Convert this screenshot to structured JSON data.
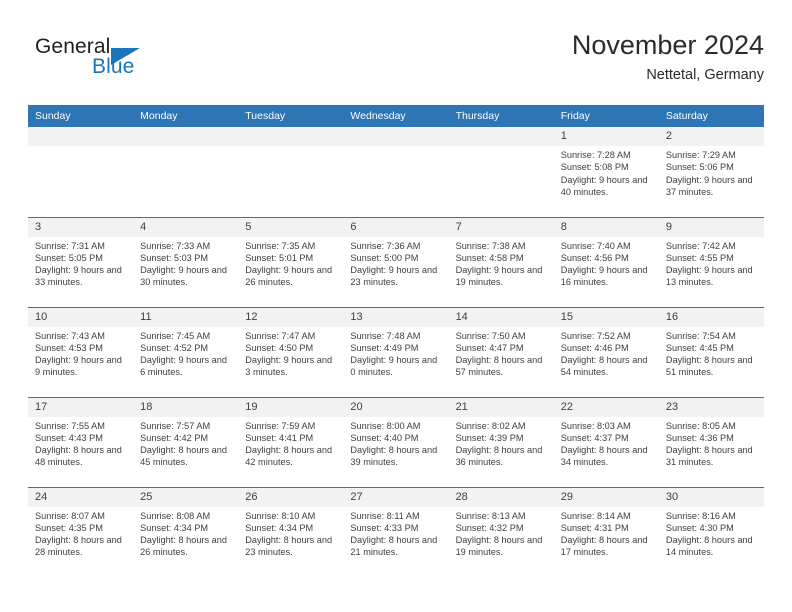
{
  "brand": {
    "name_part1": "General",
    "name_part2": "Blue",
    "accent_color": "#1b75bb",
    "logo_icon": "triangle-icon"
  },
  "header": {
    "title": "November 2024",
    "location": "Nettetal, Germany",
    "header_bg": "#2e75b6",
    "daynum_bg": "#f2f2f2"
  },
  "weekdays": [
    "Sunday",
    "Monday",
    "Tuesday",
    "Wednesday",
    "Thursday",
    "Friday",
    "Saturday"
  ],
  "weeks": [
    [
      {
        "day": "",
        "empty": true
      },
      {
        "day": "",
        "empty": true
      },
      {
        "day": "",
        "empty": true
      },
      {
        "day": "",
        "empty": true
      },
      {
        "day": "",
        "empty": true
      },
      {
        "day": "1",
        "sunrise": "Sunrise: 7:28 AM",
        "sunset": "Sunset: 5:08 PM",
        "daylight": "Daylight: 9 hours and 40 minutes."
      },
      {
        "day": "2",
        "sunrise": "Sunrise: 7:29 AM",
        "sunset": "Sunset: 5:06 PM",
        "daylight": "Daylight: 9 hours and 37 minutes."
      }
    ],
    [
      {
        "day": "3",
        "sunrise": "Sunrise: 7:31 AM",
        "sunset": "Sunset: 5:05 PM",
        "daylight": "Daylight: 9 hours and 33 minutes."
      },
      {
        "day": "4",
        "sunrise": "Sunrise: 7:33 AM",
        "sunset": "Sunset: 5:03 PM",
        "daylight": "Daylight: 9 hours and 30 minutes."
      },
      {
        "day": "5",
        "sunrise": "Sunrise: 7:35 AM",
        "sunset": "Sunset: 5:01 PM",
        "daylight": "Daylight: 9 hours and 26 minutes."
      },
      {
        "day": "6",
        "sunrise": "Sunrise: 7:36 AM",
        "sunset": "Sunset: 5:00 PM",
        "daylight": "Daylight: 9 hours and 23 minutes."
      },
      {
        "day": "7",
        "sunrise": "Sunrise: 7:38 AM",
        "sunset": "Sunset: 4:58 PM",
        "daylight": "Daylight: 9 hours and 19 minutes."
      },
      {
        "day": "8",
        "sunrise": "Sunrise: 7:40 AM",
        "sunset": "Sunset: 4:56 PM",
        "daylight": "Daylight: 9 hours and 16 minutes."
      },
      {
        "day": "9",
        "sunrise": "Sunrise: 7:42 AM",
        "sunset": "Sunset: 4:55 PM",
        "daylight": "Daylight: 9 hours and 13 minutes."
      }
    ],
    [
      {
        "day": "10",
        "sunrise": "Sunrise: 7:43 AM",
        "sunset": "Sunset: 4:53 PM",
        "daylight": "Daylight: 9 hours and 9 minutes."
      },
      {
        "day": "11",
        "sunrise": "Sunrise: 7:45 AM",
        "sunset": "Sunset: 4:52 PM",
        "daylight": "Daylight: 9 hours and 6 minutes."
      },
      {
        "day": "12",
        "sunrise": "Sunrise: 7:47 AM",
        "sunset": "Sunset: 4:50 PM",
        "daylight": "Daylight: 9 hours and 3 minutes."
      },
      {
        "day": "13",
        "sunrise": "Sunrise: 7:48 AM",
        "sunset": "Sunset: 4:49 PM",
        "daylight": "Daylight: 9 hours and 0 minutes."
      },
      {
        "day": "14",
        "sunrise": "Sunrise: 7:50 AM",
        "sunset": "Sunset: 4:47 PM",
        "daylight": "Daylight: 8 hours and 57 minutes."
      },
      {
        "day": "15",
        "sunrise": "Sunrise: 7:52 AM",
        "sunset": "Sunset: 4:46 PM",
        "daylight": "Daylight: 8 hours and 54 minutes."
      },
      {
        "day": "16",
        "sunrise": "Sunrise: 7:54 AM",
        "sunset": "Sunset: 4:45 PM",
        "daylight": "Daylight: 8 hours and 51 minutes."
      }
    ],
    [
      {
        "day": "17",
        "sunrise": "Sunrise: 7:55 AM",
        "sunset": "Sunset: 4:43 PM",
        "daylight": "Daylight: 8 hours and 48 minutes."
      },
      {
        "day": "18",
        "sunrise": "Sunrise: 7:57 AM",
        "sunset": "Sunset: 4:42 PM",
        "daylight": "Daylight: 8 hours and 45 minutes."
      },
      {
        "day": "19",
        "sunrise": "Sunrise: 7:59 AM",
        "sunset": "Sunset: 4:41 PM",
        "daylight": "Daylight: 8 hours and 42 minutes."
      },
      {
        "day": "20",
        "sunrise": "Sunrise: 8:00 AM",
        "sunset": "Sunset: 4:40 PM",
        "daylight": "Daylight: 8 hours and 39 minutes."
      },
      {
        "day": "21",
        "sunrise": "Sunrise: 8:02 AM",
        "sunset": "Sunset: 4:39 PM",
        "daylight": "Daylight: 8 hours and 36 minutes."
      },
      {
        "day": "22",
        "sunrise": "Sunrise: 8:03 AM",
        "sunset": "Sunset: 4:37 PM",
        "daylight": "Daylight: 8 hours and 34 minutes."
      },
      {
        "day": "23",
        "sunrise": "Sunrise: 8:05 AM",
        "sunset": "Sunset: 4:36 PM",
        "daylight": "Daylight: 8 hours and 31 minutes."
      }
    ],
    [
      {
        "day": "24",
        "sunrise": "Sunrise: 8:07 AM",
        "sunset": "Sunset: 4:35 PM",
        "daylight": "Daylight: 8 hours and 28 minutes."
      },
      {
        "day": "25",
        "sunrise": "Sunrise: 8:08 AM",
        "sunset": "Sunset: 4:34 PM",
        "daylight": "Daylight: 8 hours and 26 minutes."
      },
      {
        "day": "26",
        "sunrise": "Sunrise: 8:10 AM",
        "sunset": "Sunset: 4:34 PM",
        "daylight": "Daylight: 8 hours and 23 minutes."
      },
      {
        "day": "27",
        "sunrise": "Sunrise: 8:11 AM",
        "sunset": "Sunset: 4:33 PM",
        "daylight": "Daylight: 8 hours and 21 minutes."
      },
      {
        "day": "28",
        "sunrise": "Sunrise: 8:13 AM",
        "sunset": "Sunset: 4:32 PM",
        "daylight": "Daylight: 8 hours and 19 minutes."
      },
      {
        "day": "29",
        "sunrise": "Sunrise: 8:14 AM",
        "sunset": "Sunset: 4:31 PM",
        "daylight": "Daylight: 8 hours and 17 minutes."
      },
      {
        "day": "30",
        "sunrise": "Sunrise: 8:16 AM",
        "sunset": "Sunset: 4:30 PM",
        "daylight": "Daylight: 8 hours and 14 minutes."
      }
    ]
  ]
}
